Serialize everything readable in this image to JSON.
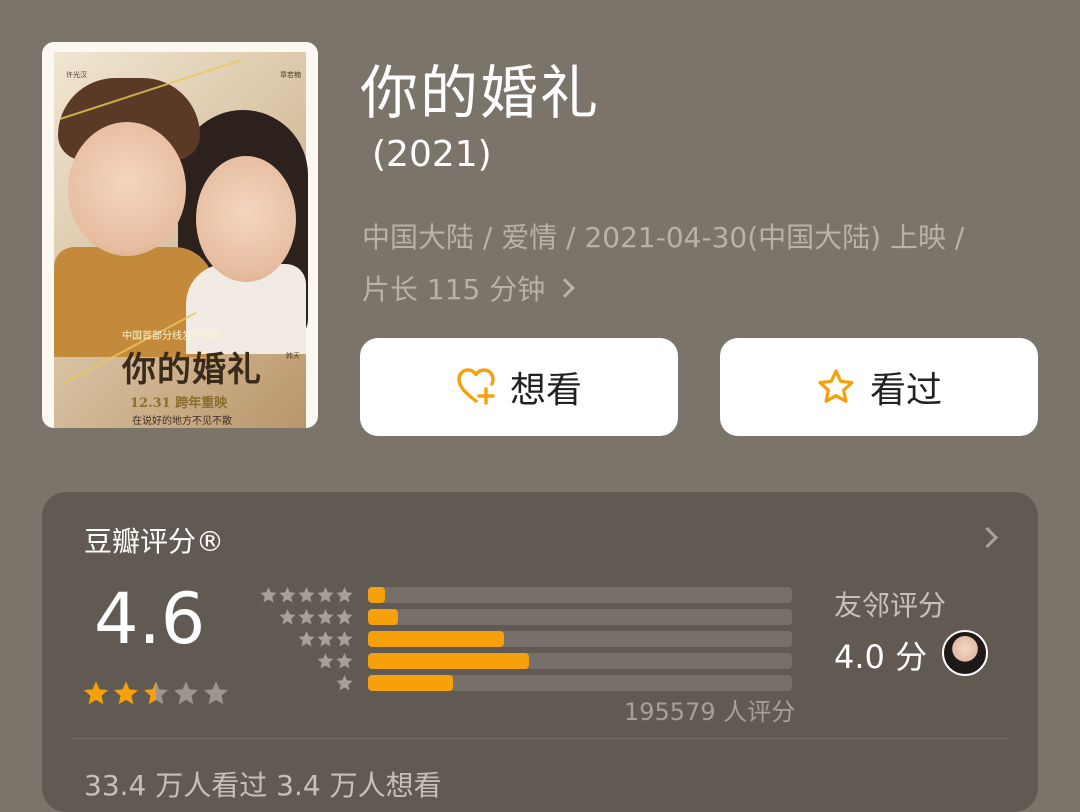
{
  "poster": {
    "actor_left": "许光汉",
    "actor_right": "章若楠",
    "subtitle": "中国首部分线发行电影",
    "title": "你的婚礼",
    "tag": "韩天",
    "date": "12.31 跨年重映",
    "slogan": "在说好的地方不见不散"
  },
  "movie": {
    "title": "你的婚礼",
    "year": "(2021)",
    "meta_line1": "中国大陆 / 爱情 / 2021-04-30(中国大陆) 上映 /",
    "meta_line2": "片长 115 分钟"
  },
  "actions": {
    "want": {
      "label": "想看",
      "icon": "heart-plus-icon"
    },
    "seen": {
      "label": "看过",
      "icon": "star-outline-icon"
    }
  },
  "rating": {
    "title": "豆瓣评分®",
    "score": "4.6",
    "stars_filled": 2.5,
    "stars_total": 5,
    "count": "195579 人评分",
    "distribution": [
      {
        "stars": 5,
        "fraction": 0.04
      },
      {
        "stars": 4,
        "fraction": 0.07
      },
      {
        "stars": 3,
        "fraction": 0.32
      },
      {
        "stars": 2,
        "fraction": 0.38
      },
      {
        "stars": 1,
        "fraction": 0.2
      }
    ],
    "friend_label": "友邻评分",
    "friend_score": "4.0 分",
    "watch_stats": "33.4 万人看过   3.4 万人想看"
  },
  "colors": {
    "background": "#7b746b",
    "card": "#615a52",
    "accent": "#f6a00c",
    "star_empty": "#9d968e"
  }
}
